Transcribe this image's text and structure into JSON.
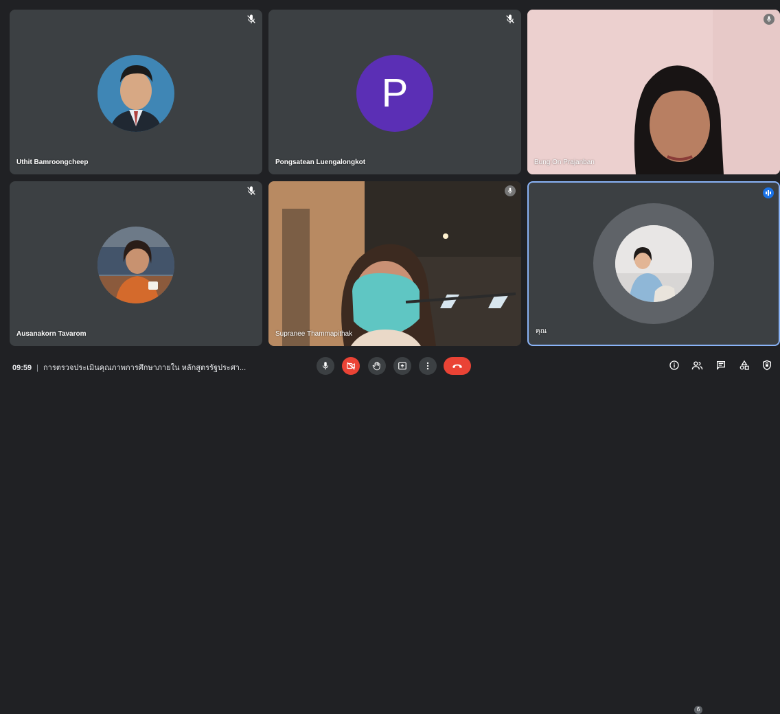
{
  "participants": [
    {
      "name": "Uthit Bamroongcheep",
      "muted": true
    },
    {
      "name": "Pongsatean Luengalongkot",
      "initial": "P",
      "muted": true
    },
    {
      "name": "Bung On Prajanban",
      "muted": true
    },
    {
      "name": "Ausanakorn Tavarom",
      "muted": true
    },
    {
      "name": "Supranee Thammapithak",
      "muted": true
    },
    {
      "name": "คุณ",
      "speaking": true
    }
  ],
  "meeting": {
    "time": "09:59",
    "separator": "|",
    "title": "การตรวจประเมินคุณภาพการศึกษาภายใน หลักสูตรรัฐประศา..."
  },
  "people_count": "6",
  "controls": [
    "mic-icon",
    "camera-off-icon",
    "raise-hand-icon",
    "present-icon",
    "more-options-icon",
    "end-call-icon"
  ],
  "right_controls": [
    "info-icon",
    "people-icon",
    "chat-icon",
    "activities-icon",
    "host-controls-icon"
  ],
  "colors": {
    "accent": "#1a73e8",
    "danger": "#ea4335",
    "tile": "#3c4043",
    "background": "#202124",
    "avatar_p": "#5b2fb5"
  }
}
